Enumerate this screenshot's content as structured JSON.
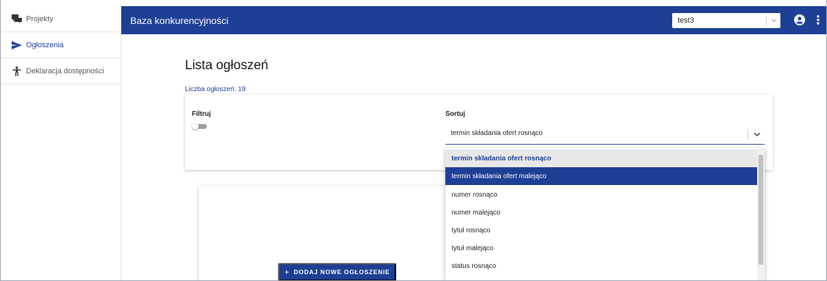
{
  "sidebar": {
    "items": [
      {
        "label": "Projekty",
        "icon": "chat-bubbles-icon"
      },
      {
        "label": "Ogłoszenia",
        "icon": "send-arrow-icon"
      },
      {
        "label": "Deklaracja dostępności",
        "icon": "accessibility-icon"
      }
    ],
    "active_index": 1
  },
  "header": {
    "title": "Baza konkurencyjności",
    "tenant_select": {
      "value": "test3"
    },
    "user_icon": "account-circle-icon",
    "menu_icon": "more-vertical-icon"
  },
  "main": {
    "title": "Lista ogłoszeń",
    "count_text": "Liczba ogłoszeń: 19",
    "filter": {
      "label": "Filtruj",
      "enabled": false
    },
    "sort": {
      "label": "Sortuj",
      "value": "termin składania ofert rosnąco",
      "options": [
        "termin składania ofert rosnąco",
        "termin składania ofert malejąco",
        "numer rosnąco",
        "numer malejąco",
        "tytuł rosnąco",
        "tytuł malejąco",
        "status rosnąco"
      ],
      "selected_index": 0,
      "hover_index": 1
    },
    "add_button": {
      "label": "DODAJ NOWE OGŁOSZENIE",
      "icon": "plus-icon"
    }
  },
  "colors": {
    "primary": "#1d3f94",
    "accent_text": "#1e3f9c"
  }
}
